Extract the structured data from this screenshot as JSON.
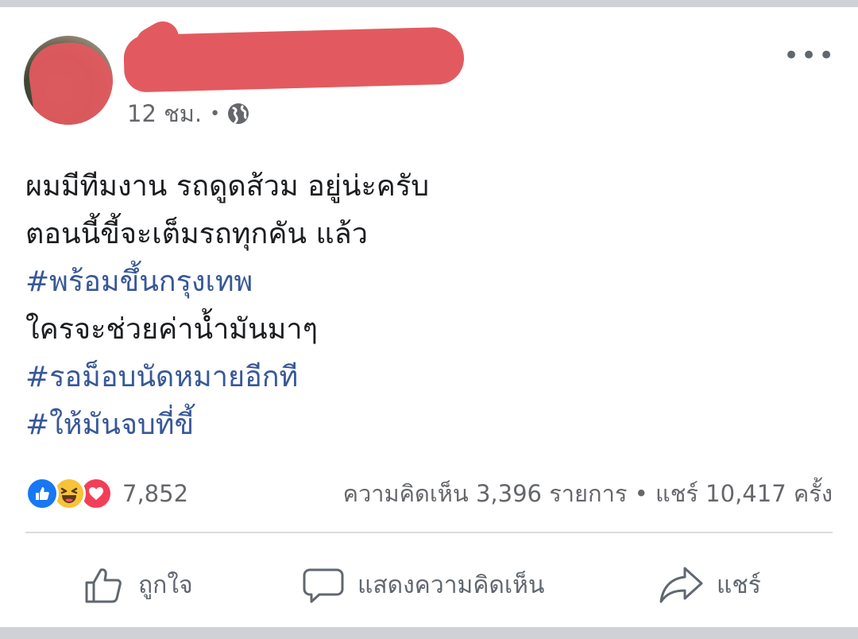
{
  "post": {
    "timestamp": "12 ชม.",
    "separator": "•",
    "privacy_icon": "globe-icon",
    "more_icon": "more-options-icon",
    "more_label": "•••",
    "lines": [
      {
        "text": "ผมมีทีมงาน รถดูดส้วม อยู่น่ะครับ",
        "is_hashtag": false
      },
      {
        "text": " ตอนนี้ขี้จะเต็มรถทุกคัน แล้ว",
        "is_hashtag": false
      },
      {
        "text": "#พร้อมขึ้นกรุงเทพ",
        "is_hashtag": true
      },
      {
        "text": "ใครจะช่วยค่าน้ำมันมาๆ",
        "is_hashtag": false
      },
      {
        "text": "#รอม็อบนัดหมายอีกที",
        "is_hashtag": true
      },
      {
        "text": "#ให้มันจบที่ขี้",
        "is_hashtag": true
      }
    ]
  },
  "stats": {
    "reaction_icons": [
      "like-reaction-icon",
      "haha-reaction-icon",
      "love-reaction-icon"
    ],
    "reaction_count": "7,852",
    "comments_shares": "ความคิดเห็น 3,396 รายการ • แชร์ 10,417 ครั้ง"
  },
  "actions": {
    "like_label": "ถูกใจ",
    "comment_label": "แสดงความคิดเห็น",
    "share_label": "แชร์"
  },
  "colors": {
    "hashtag": "#385898",
    "text": "#1c1e21",
    "secondary": "#65676b",
    "redaction": "#e25a5f"
  }
}
